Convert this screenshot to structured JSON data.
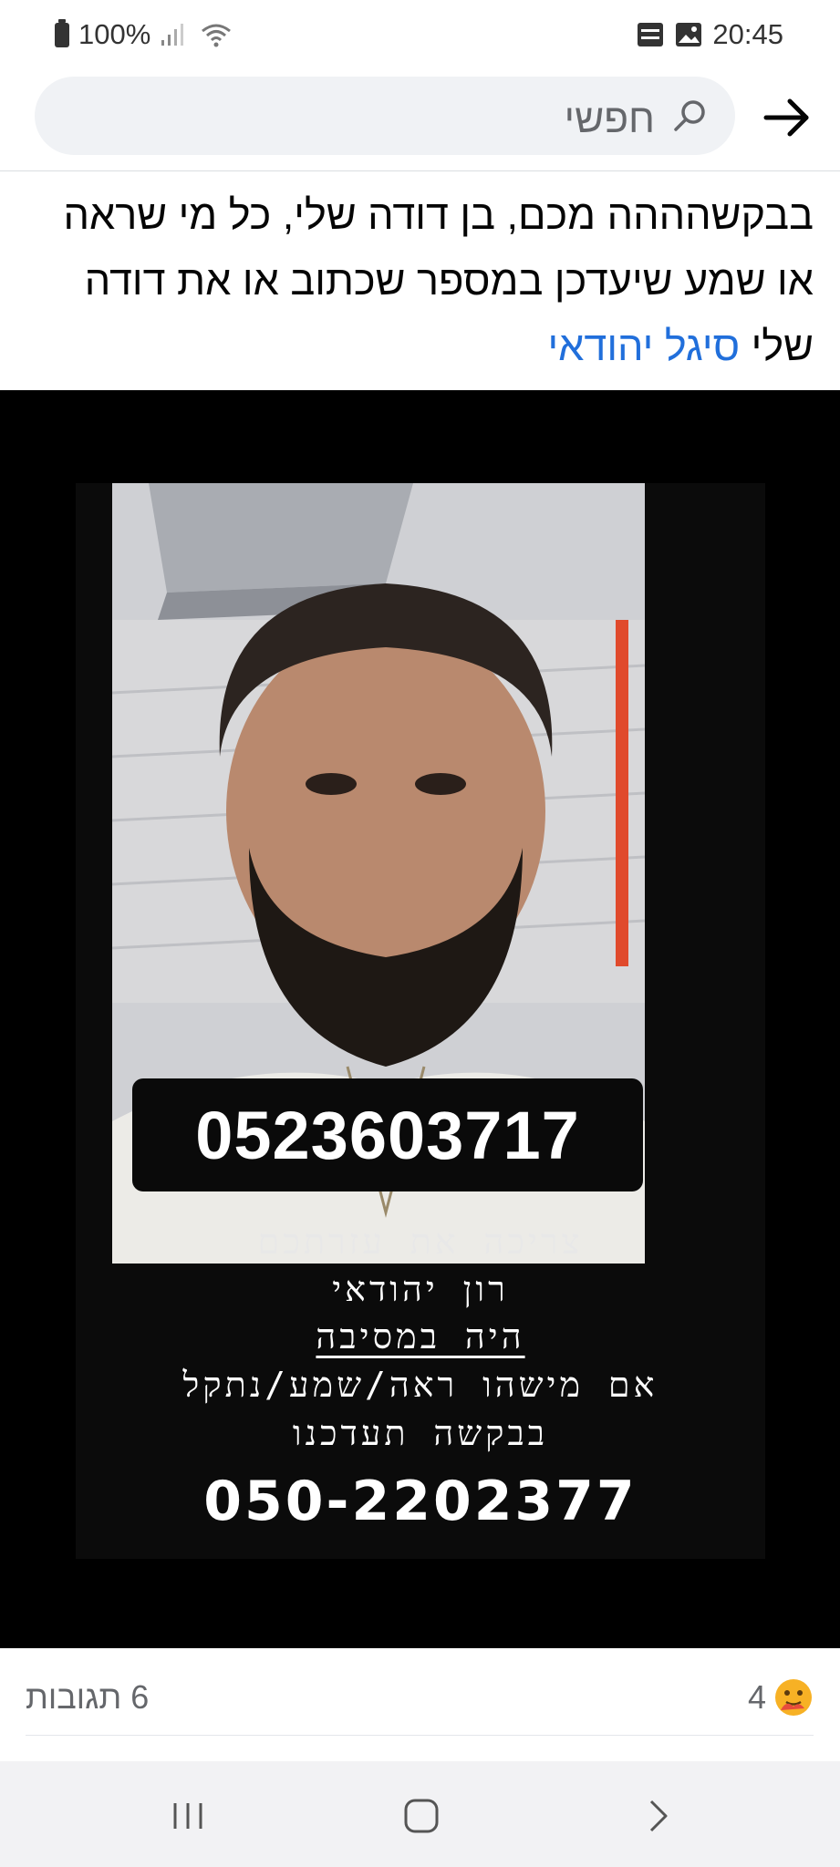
{
  "status_bar": {
    "battery": "100%",
    "time": "20:45",
    "icons": [
      "battery-icon",
      "signal-icon",
      "wifi-icon",
      "notification-icon",
      "gallery-icon"
    ]
  },
  "search": {
    "placeholder": "חפשי",
    "back_icon": "arrow-right-icon"
  },
  "post": {
    "text": "בבקשהההה מכם, בן דודה שלי, כל מי שראה או שמע שיעדכן במספר שכתוב או את דודה שלי",
    "mention": "סיגל יהודאי"
  },
  "flyer": {
    "phone_main": "0523603717",
    "lines": [
      "צריכה את עזרתכם",
      "רון יהודאי",
      "היה במסיבה",
      "אם מישהו ראה/שמע/נתקל",
      "בבקשה תעדכנו"
    ],
    "phone_secondary": "050-2202377"
  },
  "footer": {
    "comments": "6 תגובות",
    "reactions_count": "4",
    "reaction_icon": "care-emoji-icon"
  },
  "nav": {
    "buttons": [
      "recent-apps",
      "home",
      "back"
    ]
  }
}
